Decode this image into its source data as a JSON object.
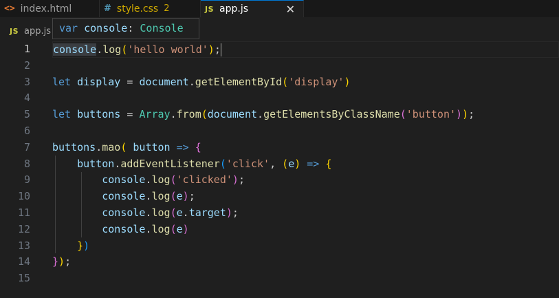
{
  "tabs": [
    {
      "icon": "<>",
      "label": "index.html"
    },
    {
      "icon": "#",
      "label": "style.css",
      "badge": "2"
    },
    {
      "icon": "JS",
      "label": "app.js",
      "close": "✕"
    }
  ],
  "breadcrumb": {
    "icon": "JS",
    "label": "app.js"
  },
  "hover": {
    "keyword": "var",
    "name": "console",
    "sep": ": ",
    "type": "Console"
  },
  "line_numbers": [
    "1",
    "2",
    "3",
    "4",
    "5",
    "6",
    "7",
    "8",
    "9",
    "10",
    "11",
    "12",
    "13",
    "14",
    "15"
  ],
  "code": {
    "l1": {
      "console": "console",
      "dot": ".",
      "log": "log",
      "op": "(",
      "str": "'hello world'",
      "cp": ")",
      "semi": ";"
    },
    "l3": {
      "let": "let",
      "sp": " ",
      "display": "display",
      "eq": " = ",
      "document": "document",
      "dot": ".",
      "fn": "getElementById",
      "op": "(",
      "str": "'display'",
      "cp": ")"
    },
    "l5": {
      "let": "let",
      "sp": " ",
      "buttons": "buttons",
      "eq": " = ",
      "Array": "Array",
      "dot": ".",
      "from": "from",
      "op1": "(",
      "document": "document",
      "dot2": ".",
      "fn": "getElementsByClassName",
      "op2": "(",
      "str": "'button'",
      "cp2": ")",
      "cp1": ")",
      "semi": ";"
    },
    "l7": {
      "buttons": "buttons",
      "dot": ".",
      "mao": "mao",
      "op": "(",
      "sp": " ",
      "button": "button",
      "arrow": " => ",
      "ob": "{"
    },
    "l8": {
      "indent": "    ",
      "button": "button",
      "dot": ".",
      "fn": "addEventListener",
      "op": "(",
      "str": "'click'",
      "comma": ", ",
      "op2": "(",
      "e": "e",
      "cp2": ")",
      "arrow": " => ",
      "ob": "{"
    },
    "l9": {
      "indent": "        ",
      "console": "console",
      "dot": ".",
      "log": "log",
      "op": "(",
      "str": "'clicked'",
      "cp": ")",
      "semi": ";"
    },
    "l10": {
      "indent": "        ",
      "console": "console",
      "dot": ".",
      "log": "log",
      "op": "(",
      "e": "e",
      "cp": ")",
      "semi": ";"
    },
    "l11": {
      "indent": "        ",
      "console": "console",
      "dot": ".",
      "log": "log",
      "op": "(",
      "e": "e",
      "dot2": ".",
      "target": "target",
      "cp": ")",
      "semi": ";"
    },
    "l12": {
      "indent": "        ",
      "console": "console",
      "dot": ".",
      "log": "log",
      "op": "(",
      "e": "e",
      "cp": ")"
    },
    "l13": {
      "indent": "    ",
      "cb": "}",
      "cp": ")"
    },
    "l14": {
      "cb": "}",
      "cp": ")",
      "semi": ";"
    }
  }
}
